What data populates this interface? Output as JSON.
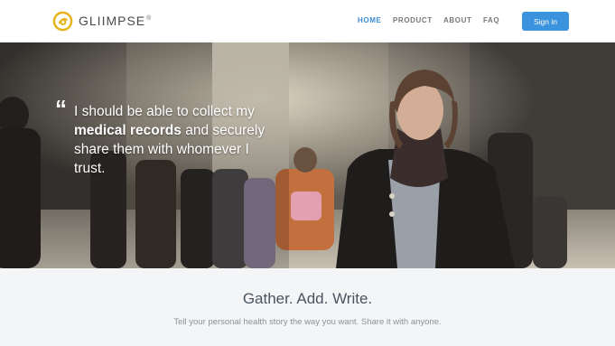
{
  "brand": {
    "name": "GLIIMPSE",
    "reg": "®",
    "accent": "#3a93dc",
    "logo_color": "#e7b31a"
  },
  "nav": {
    "items": [
      {
        "label": "HOME",
        "active": true
      },
      {
        "label": "PRODUCT",
        "active": false
      },
      {
        "label": "ABOUT",
        "active": false
      },
      {
        "label": "FAQ",
        "active": false
      }
    ],
    "signin_label": "Sign in"
  },
  "hero": {
    "quote_mark": "“",
    "quote_part1": "I should be able to collect my ",
    "quote_bold": "medical records",
    "quote_part2": " and securely share them with whomever I trust."
  },
  "features": {
    "title": "Gather. Add. Write.",
    "subtitle": "Tell your personal health story the way you want. Share it with anyone."
  }
}
